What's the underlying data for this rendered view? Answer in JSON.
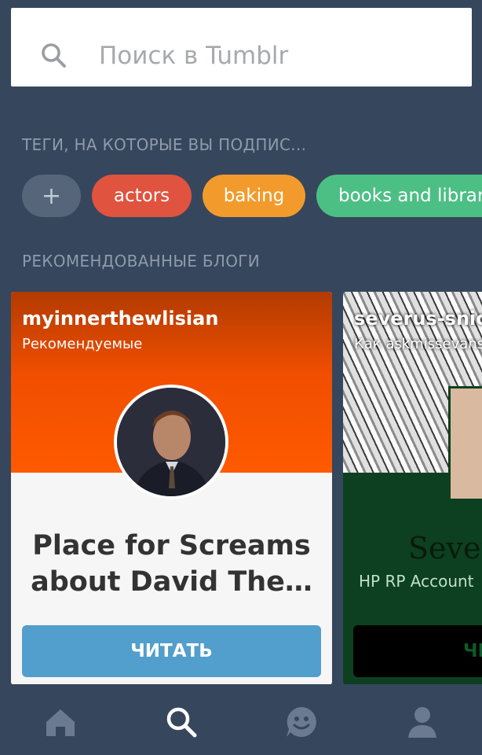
{
  "search": {
    "placeholder": "Поиск в Tumblr"
  },
  "sections": {
    "tags_title": "ТЕГИ, НА КОТОРЫЕ ВЫ ПОДПИС...",
    "blogs_title": "РЕКОМЕНДОВАННЫЕ БЛОГИ"
  },
  "tags": [
    {
      "label": "+",
      "color": "#566579"
    },
    {
      "label": "actors",
      "color": "#e0533f"
    },
    {
      "label": "baking",
      "color": "#f29b2c"
    },
    {
      "label": "books and librar",
      "color": "#4cbf85"
    }
  ],
  "blogs": [
    {
      "name": "myinnerthewlisian",
      "subtitle": "Рекомендуемые",
      "title": "Place for Screams about David The…",
      "button": "ЧИТАТЬ"
    },
    {
      "name": "severus-snick",
      "subtitle": "Как askmissevans",
      "title": "Sever",
      "description": "HP RP Account",
      "button": "ЧИ"
    }
  ],
  "nav": {
    "items": [
      "home-icon",
      "search-icon",
      "messaging-icon",
      "account-icon"
    ],
    "active": "search-icon"
  },
  "colors": {
    "background": "#36465d",
    "accent": "#529ecc"
  }
}
